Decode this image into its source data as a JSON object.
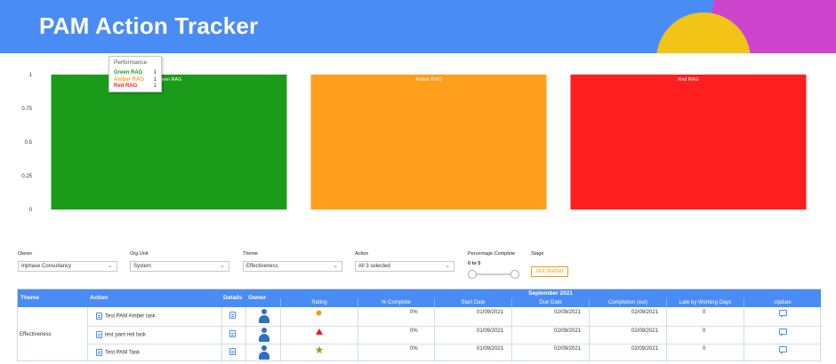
{
  "header": {
    "title": "PAM Action Tracker"
  },
  "colors": {
    "header_bg": "#4a8cf6",
    "green": "#1a9c1a",
    "amber": "#ff9f1c",
    "red": "#ff1f1f"
  },
  "chart_data": {
    "type": "bar",
    "categories": [
      "Green RAG",
      "Amber RAG",
      "Red RAG"
    ],
    "values": [
      1,
      1,
      1
    ],
    "bar_colors": [
      "#1a9c1a",
      "#ff9f1c",
      "#ff1f1f"
    ],
    "yticks": [
      0,
      0.25,
      0.5,
      0.75,
      1
    ],
    "ylim": [
      0,
      1
    ],
    "grid": false
  },
  "tooltip": {
    "title": "Performance",
    "rows": [
      {
        "label": "Green RAG",
        "value": "1",
        "color": "#1a9c1a"
      },
      {
        "label": "Amber RAG",
        "value": "1",
        "color": "#ff9f1c"
      },
      {
        "label": "Red RAG",
        "value": "1",
        "color": "#ff1f1f"
      }
    ]
  },
  "filters": {
    "owner": {
      "label": "Owner",
      "value": "Inphase Consultancy"
    },
    "org_unit": {
      "label": "Org Unit",
      "value": "System"
    },
    "theme": {
      "label": "Theme",
      "value": "Effectiveness"
    },
    "action": {
      "label": "Action",
      "value": "All 3 selected"
    },
    "percentage": {
      "label": "Percentage Complete",
      "range": "0 to 5"
    },
    "stage": {
      "label": "Stage",
      "value": "Not Started"
    }
  },
  "table": {
    "headers": {
      "theme": "Theme",
      "action": "Action",
      "details": "Details",
      "owner": "Owner"
    },
    "month": "September 2021",
    "sub_headers": [
      "Rating",
      "% Complete",
      "Start Date",
      "Due Date",
      "Completion (est)",
      "Late by Working Days",
      "Update"
    ],
    "group_theme": "Effectiveness",
    "rows": [
      {
        "action": "Test PAM Amber task",
        "rating": "amber-circle",
        "pct": "0%",
        "start": "01/09/2021",
        "due": "02/09/2021",
        "completion": "02/09/2021",
        "late": "0"
      },
      {
        "action": "test pam red task",
        "rating": "red-triangle",
        "pct": "0%",
        "start": "01/09/2021",
        "due": "02/09/2021",
        "completion": "02/09/2021",
        "late": "0"
      },
      {
        "action": "Test PAM Task",
        "rating": "green-star",
        "pct": "0%",
        "start": "01/09/2021",
        "due": "02/09/2021",
        "completion": "02/09/2021",
        "late": "0"
      }
    ]
  }
}
